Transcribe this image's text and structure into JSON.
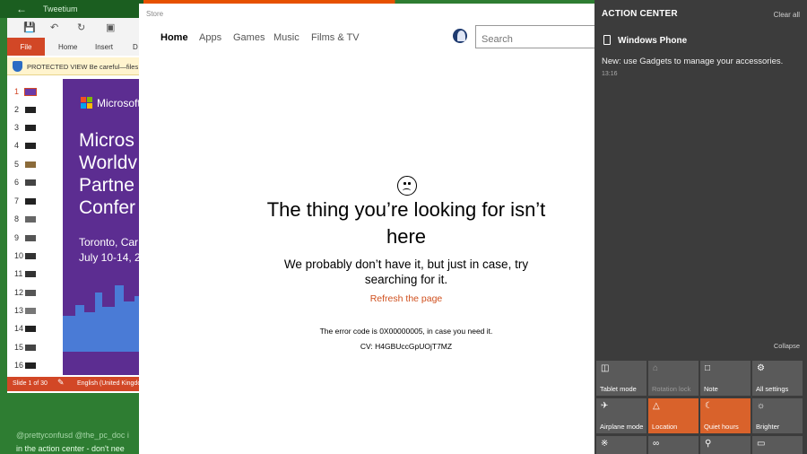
{
  "tweetium": {
    "title": "Tweetium",
    "tweet_handle": "@prettyconfusd @the_pc_doc i",
    "tweet_text": "in the action center - don't nee"
  },
  "powerpoint": {
    "tabs": [
      "File",
      "Home",
      "Insert",
      "D"
    ],
    "protected_view": "PROTECTED VIEW  Be careful—files",
    "slide_numbers": [
      "1",
      "2",
      "3",
      "4",
      "5",
      "6",
      "7",
      "8",
      "9",
      "10",
      "11",
      "12",
      "13",
      "14",
      "15",
      "16"
    ],
    "slide_brand": "Microsoft",
    "slide_big_text": "Micros\nWorldv\nPartne\nConfer",
    "slide_small_text": "Toronto, Car\nJuly 10-14, 2",
    "status_slide": "Slide 1 of 30",
    "status_language": "English (United Kingdo"
  },
  "store": {
    "window_title": "Store",
    "nav": [
      "Home",
      "Apps",
      "Games",
      "Music",
      "Films & TV"
    ],
    "search_placeholder": "Search",
    "error_title": "The thing you’re looking for isn’t here",
    "error_subtitle": "We probably don’t have it, but just in case, try searching for it.",
    "refresh_link": "Refresh the page",
    "error_code": "The error code is 0X00000005, in case you need it.",
    "cv": "CV: H4GBUccGpUOjT7MZ"
  },
  "action_center": {
    "title": "ACTION CENTER",
    "clear_all": "Clear all",
    "notification": {
      "app": "Windows Phone",
      "body": "New: use Gadgets to manage your accessories.",
      "time": "13:16"
    },
    "collapse": "Collapse",
    "tiles": [
      {
        "label": "Tablet mode",
        "icon": "tablet-mode-icon",
        "state": "off"
      },
      {
        "label": "Rotation lock",
        "icon": "rotation-lock-icon",
        "state": "disabled"
      },
      {
        "label": "Note",
        "icon": "note-icon",
        "state": "off"
      },
      {
        "label": "All settings",
        "icon": "gear-icon",
        "state": "off"
      },
      {
        "label": "Airplane mode",
        "icon": "airplane-icon",
        "state": "off"
      },
      {
        "label": "Location",
        "icon": "location-icon",
        "state": "on"
      },
      {
        "label": "Quiet hours",
        "icon": "moon-icon",
        "state": "on"
      },
      {
        "label": "Brighter",
        "icon": "brightness-icon",
        "state": "off"
      }
    ],
    "accent_color": "#d9622b"
  }
}
